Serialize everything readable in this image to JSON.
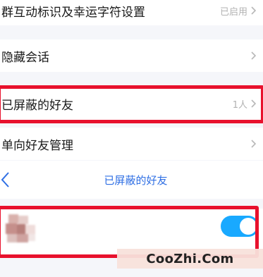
{
  "settings": {
    "group_badge_row": {
      "label": "群互动标识及幸运字符设置",
      "value": "已启用"
    },
    "hidden_chats_row": {
      "label": "隐藏会话"
    },
    "blocked_friends_row": {
      "label": "已屏蔽的好友",
      "value": "1人"
    },
    "oneway_friends_row": {
      "label": "单向好友管理"
    }
  },
  "blocked_page": {
    "title": "已屏蔽的好友",
    "friends": [
      {
        "name": "",
        "blocked": true
      }
    ]
  },
  "watermark": {
    "text": "CooZhi.Com"
  },
  "colors": {
    "accent": "#2f6fe4",
    "toggle_on": "#19a9ff",
    "highlight_box": "#e8112d"
  },
  "icons": {
    "row_arrow": "chevron-right-icon",
    "back": "chevron-left-icon"
  }
}
